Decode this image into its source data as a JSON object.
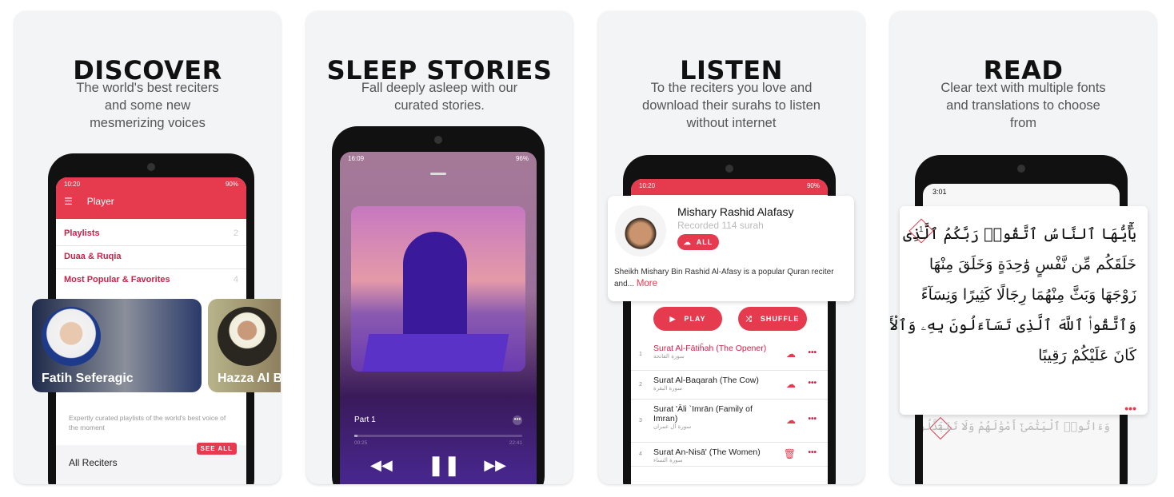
{
  "accent": "#e63a4e",
  "panels": [
    {
      "title": "DISCOVER",
      "subtitle": "The world's best reciters and some new mesmerizing voices",
      "phone": {
        "status_time": "10:20",
        "battery": "90%",
        "app_bar_title": "Player",
        "menu": [
          {
            "label": "Playlists",
            "count": "2"
          },
          {
            "label": "Duaa & Ruqia",
            "count": ""
          },
          {
            "label": "Most Popular & Favorites",
            "count": "4"
          }
        ],
        "reciters": [
          "Fatih Seferagic",
          "Hazza Al B"
        ],
        "description": "Expertly curated playlists of the world's best voice of the moment",
        "see_all": "SEE ALL",
        "section": "All Reciters"
      }
    },
    {
      "title": "SLEEP STORIES",
      "subtitle": "Fall deeply asleep with our curated stories.",
      "phone": {
        "status_time": "16:09",
        "battery": "96%",
        "track": "Part 1",
        "elapsed": "00:25",
        "duration": "22:41",
        "progress": 0.018
      }
    },
    {
      "title": "LISTEN",
      "subtitle": "To the reciters you love and download their surahs to listen without internet",
      "phone": {
        "status_time": "10:20",
        "battery": "90%",
        "reciter": "Mishary Rashid Alafasy",
        "recorded": "Recorded 114 surah",
        "all_label": "ALL",
        "bio": "Sheikh Mishary Bin Rashid Al-Afasy is a popular Quran reciter and...",
        "more": "More",
        "play": "PLAY",
        "shuffle": "SHUFFLE",
        "surahs": [
          {
            "n": "1",
            "name": "Surat Al-Fātiĥah (The Opener)",
            "ar": "سورة الفاتحة",
            "icon": "cloud-download"
          },
          {
            "n": "2",
            "name": "Surat Al-Baqarah (The Cow)",
            "ar": "سورة البقرة",
            "icon": "cloud-download"
          },
          {
            "n": "3",
            "name": "Surat 'Āli `Imrān (Family of Imran)",
            "ar": "سورة آل عمران",
            "icon": "cloud-download"
          },
          {
            "n": "4",
            "name": "Surat An-Nisā' (The Women)",
            "ar": "سورة النساء",
            "icon": "trash"
          }
        ]
      }
    },
    {
      "title": "READ",
      "subtitle": "Clear text with multiple fonts and translations to choose from",
      "phone": {
        "status_time": "3:01",
        "verse1_num": "1",
        "verse1_lines": [
          "يَٰٓأَيُّهَا ٱلنَّاسُ ٱتَّقُوا۟ رَبَّكُمُ ٱلَّذِى",
          "خَلَقَكُم مِّن نَّفْسٍ وَٰحِدَةٍ وَخَلَقَ مِنْهَا",
          "زَوْجَهَا وَبَثَّ مِنْهُمَا رِجَالًا كَثِيرًا وَنِسَآءً",
          "وَٱتَّقُوا۟ ٱللَّهَ ٱلَّذِى تَسَآءَلُونَ بِهِۦ وَٱلْأَرْحَامَ إِنَّ ٱللَّهَ",
          "كَانَ عَلَيْكُمْ رَقِيبًا"
        ],
        "verse2_num": "2",
        "verse2_line": "وَءَاتُوا۟ ٱلْيَتَٰمَىٰٓ أَمْوَٰلَهُمْ وَلَا تَتَبَدَّلُوا۟ ٱلْخَبِيثَ"
      }
    }
  ]
}
